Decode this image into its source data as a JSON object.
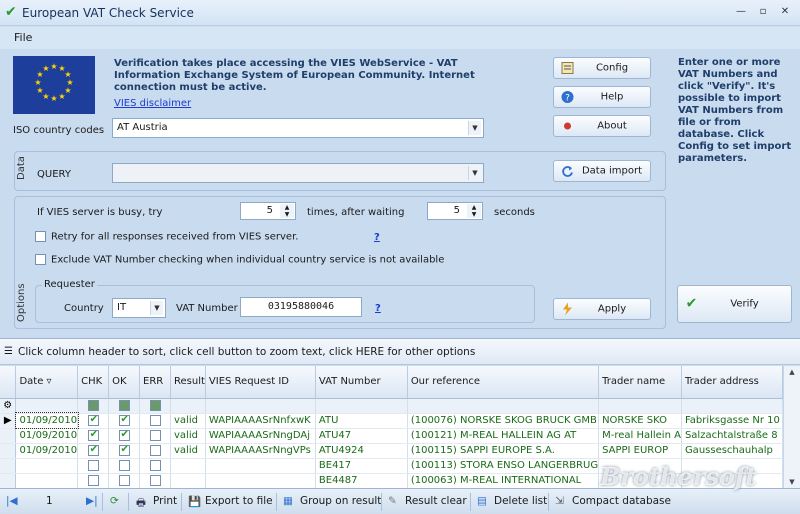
{
  "window": {
    "title": "European VAT Check Service"
  },
  "menu": {
    "file": "File"
  },
  "header": {
    "info": "Verification takes place accessing the VIES WebService - VAT Information Exchange System of European Community. Internet connection must be active.",
    "vies_link": "VIES disclaimer",
    "iso_label": "ISO country codes",
    "iso_value": "AT Austria"
  },
  "buttons": {
    "config": "Config",
    "help": "Help",
    "about": "About",
    "data_import": "Data import",
    "apply": "Apply",
    "verify": "Verify"
  },
  "hint": "Enter one or more VAT Numbers and click \"Verify\". It's possible to import VAT Numbers from file or from database. Click Config to set import parameters.",
  "data_group": {
    "label": "Data",
    "query_label": "QUERY",
    "query_value": ""
  },
  "options": {
    "label": "Options",
    "busy_label": "If VIES server is busy, try",
    "tries": "5",
    "times_label": "times, after waiting",
    "seconds": "5",
    "seconds_label": "seconds",
    "retry_label": "Retry for all responses received from VIES server.",
    "exclude_label": "Exclude VAT Number checking when individual country service is not available",
    "help_link": "?"
  },
  "requester": {
    "label": "Requester",
    "country_label": "Country",
    "country_value": "IT",
    "vat_label": "VAT Number",
    "vat_value": "03195880046",
    "help_link": "?"
  },
  "grid": {
    "toolbar_text": "Click column header to sort, click cell button to zoom text, click HERE for other options",
    "columns": [
      "Date",
      "CHK",
      "OK",
      "ERR",
      "Result",
      "VIES Request ID",
      "VAT Number",
      "Our reference",
      "Trader name",
      "Trader address"
    ],
    "rows": [
      {
        "date": "01/09/2010",
        "chk": true,
        "ok": true,
        "err": false,
        "result": "valid",
        "req": "WAPIAAAASrNnfxwK",
        "vat": "ATU",
        "ref": "(100076) NORSKE SKOG BRUCK GMB",
        "name": "NORSKE SKO",
        "addr": "Fabriksgasse Nr 10"
      },
      {
        "date": "01/09/2010",
        "chk": true,
        "ok": true,
        "err": false,
        "result": "valid",
        "req": "WAPIAAAASrNngDAj",
        "vat": "ATU47",
        "ref": "(100121) M-REAL HALLEIN AG AT",
        "name": "M-real Hallein A",
        "addr": "Salzachtalstraße 8"
      },
      {
        "date": "01/09/2010",
        "chk": true,
        "ok": true,
        "err": false,
        "result": "valid",
        "req": "WAPIAAAASrNngVPs",
        "vat": "ATU4924",
        "ref": "(100115) SAPPI EUROPE S.A.",
        "name": "SAPPI EUROP",
        "addr": "Gausseschauhalp"
      },
      {
        "date": "",
        "chk": false,
        "ok": false,
        "err": false,
        "result": "",
        "req": "",
        "vat": "BE417",
        "ref": "(100113) STORA ENSO LANGERBRUG",
        "name": "",
        "addr": ""
      },
      {
        "date": "",
        "chk": false,
        "ok": false,
        "err": false,
        "result": "",
        "req": "",
        "vat": "BE4487",
        "ref": "(100063) M-REAL INTERNATIONAL",
        "name": "",
        "addr": ""
      }
    ]
  },
  "navigator": {
    "page": "1",
    "print": "Print",
    "export": "Export to file",
    "group": "Group on result",
    "clear": "Result clear",
    "delete": "Delete list",
    "compact": "Compact database"
  },
  "watermark": "Brothersoft"
}
